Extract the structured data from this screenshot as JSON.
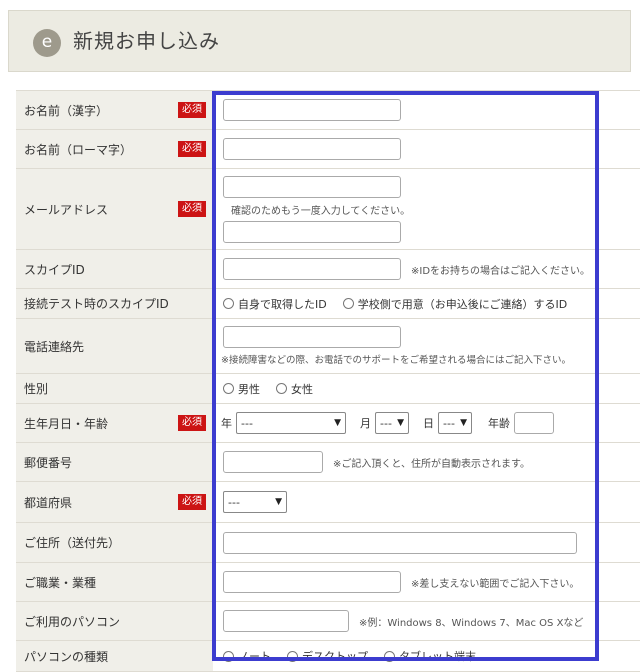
{
  "header": {
    "icon": "e",
    "title": "新規お申し込み"
  },
  "required_label": "必須",
  "rows": {
    "name_kanji": {
      "label": "お名前（漢字）"
    },
    "name_roman": {
      "label": "お名前（ローマ字）"
    },
    "email": {
      "label": "メールアドレス",
      "confirm_note": "確認のためもう一度入力してください。"
    },
    "skype": {
      "label": "スカイプID",
      "note": "※IDをお持ちの場合はご記入ください。"
    },
    "skype_test": {
      "label": "接続テスト時のスカイプID",
      "option1": "自身で取得したID",
      "option2": "学校側で用意（お申込後にご連絡）するID"
    },
    "phone": {
      "label": "電話連絡先",
      "note": "※接続障害などの際、お電話でのサポートをご希望される場合にはご記入下さい。"
    },
    "gender": {
      "label": "性別",
      "option1": "男性",
      "option2": "女性"
    },
    "birth": {
      "label": "生年月日・年齢",
      "year_label": "年",
      "year_value": "---",
      "month_label": "月",
      "month_value": "---",
      "day_label": "日",
      "day_value": "---",
      "age_label": "年齢"
    },
    "postal": {
      "label": "郵便番号",
      "note": "※ご記入頂くと、住所が自動表示されます。"
    },
    "prefecture": {
      "label": "都道府県",
      "value": "---"
    },
    "address": {
      "label": "ご住所（送付先）"
    },
    "occupation": {
      "label": "ご職業・業種",
      "note": "※差し支えない範囲でご記入下さい。"
    },
    "pc": {
      "label": "ご利用のパソコン",
      "note": "※例：Windows 8、Windows 7、Mac OS Xなど"
    },
    "pc_type": {
      "label": "パソコンの種類",
      "option1": "ノート",
      "option2": "デスクトップ",
      "option3": "タブレット端末"
    }
  }
}
